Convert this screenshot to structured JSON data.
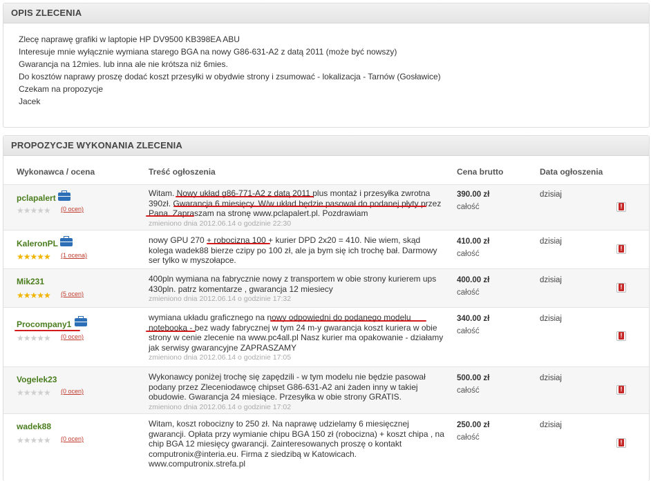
{
  "description": {
    "title": "OPIS ZLECENIA",
    "lines": [
      "Zlecę naprawę grafiki w laptopie HP DV9500 KB398EA ABU",
      "Interesuje mnie wyłącznie wymiana starego BGA na nowy G86-631-A2 z datą 2011 (może być nowszy)",
      "Gwarancja na 12mies. lub inna ale nie krótsza niż 6mies.",
      "Do kosztów naprawy proszę dodać koszt przesyłki w obydwie strony i zsumować - lokalizacja - Tarnów (Gosławice)",
      "Czekam na propozycje",
      "Jacek"
    ]
  },
  "offers": {
    "title": "PROPOZYCJE WYKONANIA ZLECENIA",
    "headers": {
      "contractor": "Wykonawca / ocena",
      "content": "Treść ogłoszenia",
      "price": "Cena brutto",
      "date": "Data ogłoszenia"
    },
    "rows": [
      {
        "name": "pclapalert",
        "badge": "briefcase-icon",
        "stars": 0,
        "rating": "(0 ocen)",
        "text": "Witam. Nowy układ g86-771-A2 z datą 2011 plus montaż i przesyłka zwrotna 390zł. Gwarancja 6 miesięcy. W/w układ będzie pasował do podanej płyty przez Pana. Zapraszam na stronę www.pclapalert.pl. Pozdrawiam",
        "edited": "zmieniono dnia 2012.06.14 o godzinie 22:30",
        "price": "390.00 zł",
        "scope": "całość",
        "date": "dzisiaj"
      },
      {
        "name": "KaleronPL",
        "badge": "briefcase-icon",
        "stars": 5,
        "rating": "(1 ocena)",
        "text": "nowy GPU 270 + robocizna 100 + kurier DPD 2x20 = 410. Nie wiem, skąd kolega wadek88 bierze czipy po 100 zł, ale ja bym się ich trochę bał. Darmowy ser tylko w myszołapce.",
        "edited": "",
        "price": "410.00 zł",
        "scope": "całość",
        "date": "dzisiaj"
      },
      {
        "name": "Mik231",
        "badge": "",
        "stars": 5,
        "rating": "(5 ocen)",
        "text": "400pln wymiana na fabrycznie nowy z transportem w obie strony kurierem ups 430pln. patrz komentarze , gwarancja 12 miesiecy",
        "edited": "zmieniono dnia 2012.06.14 o godzinie 17:32",
        "price": "400.00 zł",
        "scope": "całość",
        "date": "dzisiaj"
      },
      {
        "name": "Procompany1",
        "badge": "briefcase-icon",
        "stars": 0,
        "rating": "(0 ocen)",
        "text": "wymiana układu graficznego na nowy odpowiedni do podanego modelu notebooka - bez wady fabrycznej w tym 24 m-y gwarancja koszt kuriera w obie strony w cenie zlecenie na www.pc4all.pl Nasz kurier ma opakowanie - działamy jak serwisy gwarancyjne ZAPRASZAMY",
        "edited": "zmieniono dnia 2012.06.14 o godzinie 17:05",
        "price": "340.00 zł",
        "scope": "całość",
        "date": "dzisiaj"
      },
      {
        "name": "Vogelek23",
        "badge": "",
        "stars": 0,
        "rating": "(0 ocen)",
        "text": "Wykonawcy poniżej trochę się zapędzili - w tym modelu nie będzie pasował podany przez Zleceniodawcę chipset G86-631-A2 ani żaden inny w takiej obudowie. Gwarancja 24 miesiące. Przesyłka w obie strony GRATIS.",
        "edited": "zmieniono dnia 2012.06.14 o godzinie 17:02",
        "price": "500.00 zł",
        "scope": "całość",
        "date": "dzisiaj"
      },
      {
        "name": "wadek88",
        "badge": "",
        "stars": 0,
        "rating": "(0 ocen)",
        "text": "Witam, koszt robocizny to 250 zł. Na naprawę udzielamy 6 miesięcznej gwarancji. Opłata przy wymianie chipu BGA 150 zł (robocizna) + koszt chipa , na chip BGA 12 miesięcy gwarancji. Zainteresowanych proszę o kontakt computronix@interia.eu. Firma z siedzibą w Katowicach. www.computronix.strefa.pl",
        "edited": "",
        "price": "250.00 zł",
        "scope": "całość",
        "date": "dzisiaj"
      }
    ]
  },
  "colors": {
    "name_green": "#4a7d1d",
    "star": "#f0b400",
    "underline_red": "#d31b1b",
    "report_red": "#c62828"
  }
}
